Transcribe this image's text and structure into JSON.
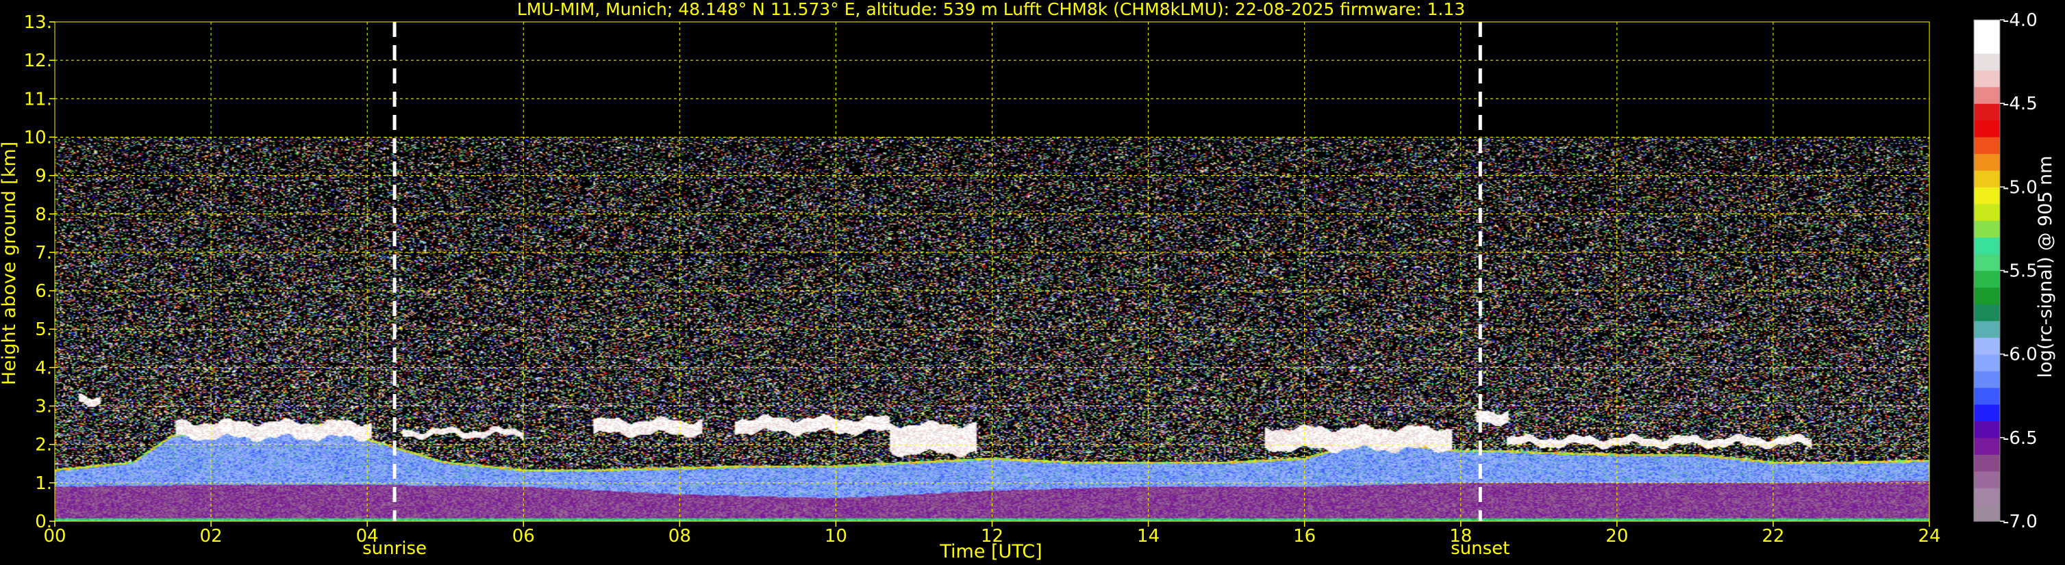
{
  "chart_data": {
    "type": "heatmap",
    "title": "LMU-MIM, Munich; 48.148° N 11.573° E, altitude: 539 m    Lufft CHM8k (CHM8kLMU): 22-08-2025    firmware: 1.13",
    "xlabel": "Time [UTC]",
    "ylabel": "Height above ground [km]",
    "colorbar_label": "log(rc-signal) @ 905 nm",
    "xlim": [
      0,
      24
    ],
    "ylim": [
      0,
      13
    ],
    "x_ticks": [
      0,
      2,
      4,
      6,
      8,
      10,
      12,
      14,
      16,
      18,
      20,
      22,
      24
    ],
    "x_tick_labels": [
      "00",
      "02",
      "04",
      "06",
      "08",
      "10",
      "12",
      "14",
      "16",
      "18",
      "20",
      "22",
      "24"
    ],
    "y_ticks": [
      0,
      1,
      2,
      3,
      4,
      5,
      6,
      7,
      8,
      9,
      10,
      11,
      12,
      13
    ],
    "y_tick_labels": [
      "0.",
      "1.",
      "2.",
      "3.",
      "4.",
      "5.",
      "6.",
      "7.",
      "8.",
      "9.",
      "10.",
      "11.",
      "12.",
      "13."
    ],
    "grid": true,
    "data_top_km": 10,
    "sunrise_utc": 4.35,
    "sunset_utc": 18.25,
    "annotations": [
      {
        "label": "sunrise",
        "x": 4.35
      },
      {
        "label": "sunset",
        "x": 18.25
      }
    ],
    "colorbar": {
      "range": [
        -7.0,
        -4.0
      ],
      "ticks": [
        -7.0,
        -6.5,
        -6.0,
        -5.5,
        -5.0,
        -4.5,
        -4.0
      ],
      "tick_labels": [
        "-7.0",
        "-6.5",
        "-6.0",
        "-5.5",
        "-5.0",
        "-4.5",
        "-4.0"
      ],
      "colors": [
        "#9c8a9c",
        "#a585a5",
        "#9a6a9a",
        "#8a4a8a",
        "#7a1a9a",
        "#5a0ab0",
        "#2020ff",
        "#3a5aff",
        "#6a8aff",
        "#8aa8ff",
        "#a0b8ff",
        "#5ab0b0",
        "#1a8a5a",
        "#1a9a2a",
        "#2ab84a",
        "#4ad87a",
        "#3ae09a",
        "#8ae04a",
        "#c8e81a",
        "#f0f01a",
        "#f0c81a",
        "#f0901a",
        "#f0501a",
        "#e80a0a",
        "#e01a1a",
        "#e88a8a",
        "#f0c8c8",
        "#e8e0e0",
        "#ffffff",
        "#ffffff"
      ]
    },
    "signal_layers": {
      "boundary_layer_top_km": [
        [
          0,
          1.3
        ],
        [
          0.5,
          1.4
        ],
        [
          1.0,
          1.5
        ],
        [
          1.5,
          2.2
        ],
        [
          2.0,
          2.25
        ],
        [
          2.5,
          2.3
        ],
        [
          3.0,
          2.4
        ],
        [
          3.5,
          2.5
        ],
        [
          4.0,
          2.1
        ],
        [
          4.5,
          1.8
        ],
        [
          5.0,
          1.5
        ],
        [
          5.5,
          1.4
        ],
        [
          6.0,
          1.3
        ],
        [
          7.0,
          1.3
        ],
        [
          8.0,
          1.35
        ],
        [
          9.0,
          1.4
        ],
        [
          10.0,
          1.4
        ],
        [
          11.0,
          1.5
        ],
        [
          12.0,
          1.6
        ],
        [
          13.0,
          1.5
        ],
        [
          14.0,
          1.5
        ],
        [
          15.0,
          1.5
        ],
        [
          16.0,
          1.6
        ],
        [
          16.5,
          1.9
        ],
        [
          17.0,
          2.1
        ],
        [
          17.5,
          1.9
        ],
        [
          18.0,
          1.8
        ],
        [
          18.5,
          1.8
        ],
        [
          19.0,
          1.75
        ],
        [
          20.0,
          1.7
        ],
        [
          21.0,
          1.7
        ],
        [
          22.0,
          1.5
        ],
        [
          23.0,
          1.5
        ],
        [
          24.0,
          1.55
        ]
      ],
      "residual_layer_top_km": [
        [
          0,
          0.9
        ],
        [
          2,
          0.95
        ],
        [
          4,
          0.95
        ],
        [
          6,
          0.9
        ],
        [
          8,
          0.7
        ],
        [
          10,
          0.6
        ],
        [
          12,
          0.8
        ],
        [
          14,
          0.9
        ],
        [
          16,
          0.9
        ],
        [
          18,
          1.0
        ],
        [
          20,
          1.0
        ],
        [
          22,
          1.0
        ],
        [
          24,
          1.05
        ]
      ],
      "cloud_layers": [
        {
          "t0": 1.55,
          "t1": 4.05,
          "base_km": 2.2,
          "top_km": 2.55
        },
        {
          "t0": 4.45,
          "t1": 6.0,
          "base_km": 2.25,
          "top_km": 2.35
        },
        {
          "t0": 6.9,
          "t1": 8.3,
          "base_km": 2.3,
          "top_km": 2.6
        },
        {
          "t0": 8.7,
          "t1": 10.7,
          "base_km": 2.35,
          "top_km": 2.65
        },
        {
          "t0": 10.7,
          "t1": 11.8,
          "base_km": 1.8,
          "top_km": 2.5
        },
        {
          "t0": 15.5,
          "t1": 17.9,
          "base_km": 1.9,
          "top_km": 2.4
        },
        {
          "t0": 18.2,
          "t1": 18.6,
          "base_km": 2.6,
          "top_km": 2.85
        },
        {
          "t0": 18.6,
          "t1": 22.5,
          "base_km": 2.0,
          "top_km": 2.15
        },
        {
          "t0": 0.3,
          "t1": 0.6,
          "base_km": 3.1,
          "top_km": 3.25
        }
      ]
    }
  }
}
